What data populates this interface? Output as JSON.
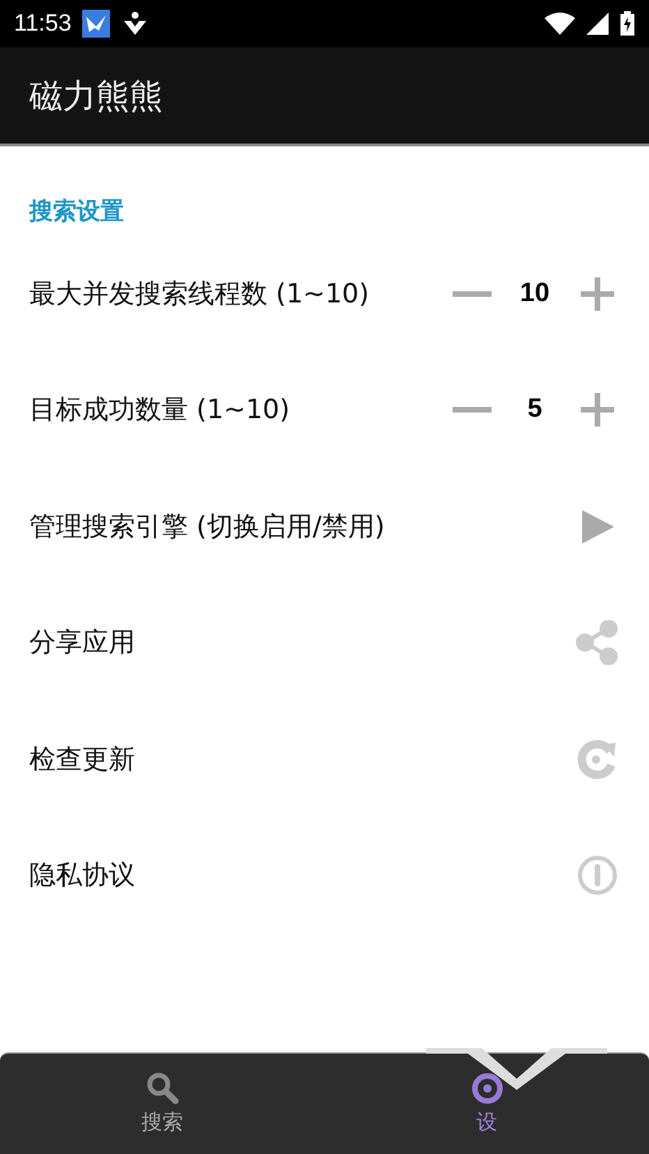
{
  "status_bar": {
    "time": "11:53"
  },
  "app_bar": {
    "title": "磁力熊熊"
  },
  "section": {
    "title": "搜索设置"
  },
  "settings": [
    {
      "kind": "stepper",
      "label": "最大并发搜索线程数 (1~10)",
      "value": "10"
    },
    {
      "kind": "stepper",
      "label": "目标成功数量 (1~10)",
      "value": "5"
    },
    {
      "kind": "action",
      "label": "管理搜索引擎 (切换启用/禁用)"
    },
    {
      "kind": "action",
      "label": "分享应用"
    },
    {
      "kind": "action",
      "label": "检查更新"
    },
    {
      "kind": "action",
      "label": "隐私协议"
    }
  ],
  "bottom_nav": [
    {
      "label": "搜索",
      "selected": false
    },
    {
      "label": "设",
      "selected": true
    }
  ]
}
